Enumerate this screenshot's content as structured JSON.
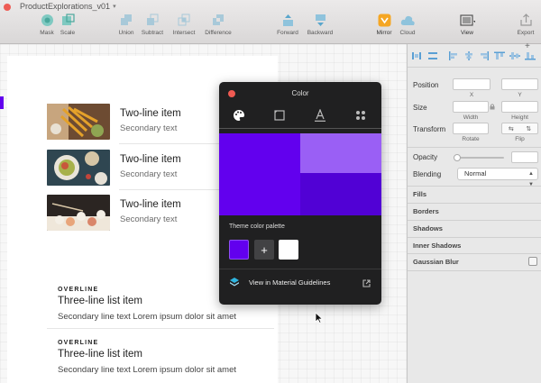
{
  "window": {
    "title": "ProductExplorations_v01"
  },
  "toolbar": {
    "mask": "Mask",
    "scale": "Scale",
    "union": "Union",
    "subtract": "Subtract",
    "intersect": "Intersect",
    "difference": "Difference",
    "forward": "Forward",
    "backward": "Backward",
    "mirror": "Mirror",
    "cloud": "Cloud",
    "view": "View",
    "export": "Export"
  },
  "list_two_line": [
    {
      "title": "Two-line item",
      "secondary": "Secondary text"
    },
    {
      "title": "Two-line item",
      "secondary": "Secondary text"
    },
    {
      "title": "Two-line item",
      "secondary": "Secondary text"
    }
  ],
  "list_three_line": [
    {
      "overline": "OVERLINE",
      "title": "Three-line list item",
      "secondary": "Secondary line text Lorem ipsum dolor sit amet"
    },
    {
      "overline": "OVERLINE",
      "title": "Three-line list item",
      "secondary": "Secondary line text Lorem ipsum dolor sit amet"
    }
  ],
  "color_popover": {
    "title": "Color",
    "palette_label": "Theme color palette",
    "guidelines_link": "View in Material Guidelines",
    "colors": {
      "primary": "#6200ee",
      "primary_light": "#9a5ff5",
      "primary_dark": "#5101d5",
      "white": "#ffffff"
    }
  },
  "inspector": {
    "position": "Position",
    "size": "Size",
    "transform": "Transform",
    "x": "X",
    "y": "Y",
    "width": "Width",
    "height": "Height",
    "rotate": "Rotate",
    "flip": "Flip",
    "opacity": "Opacity",
    "blending": "Blending",
    "blending_value": "Normal",
    "fills": "Fills",
    "borders": "Borders",
    "shadows": "Shadows",
    "inner_shadows": "Inner Shadows",
    "gaussian_blur": "Gaussian Blur"
  }
}
